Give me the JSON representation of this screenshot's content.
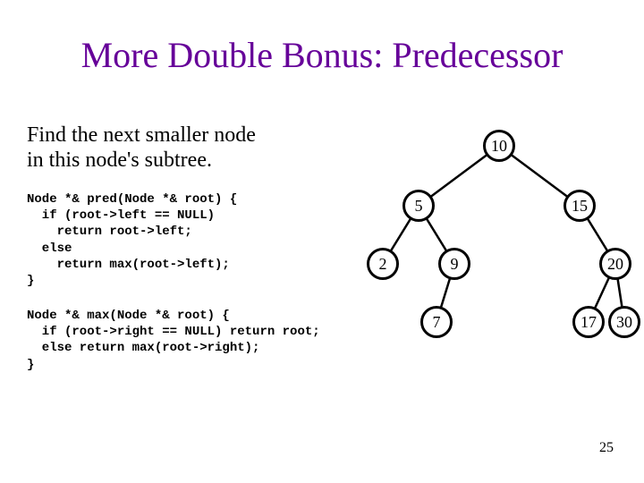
{
  "title": "More Double Bonus: Predecessor",
  "subtitle_l1": "Find the next smaller node",
  "subtitle_l2": "in this node's subtree.",
  "code1": "Node *& pred(Node *& root) {\n  if (root->left == NULL)\n    return root->left;\n  else\n    return max(root->left);\n}",
  "code2": "Node *& max(Node *& root) {\n  if (root->right == NULL) return root;\n  else return max(root->right);\n}",
  "slide_number": "25",
  "tree": {
    "n10": "10",
    "n5": "5",
    "n15": "15",
    "n2": "2",
    "n9": "9",
    "n20": "20",
    "n7": "7",
    "n17": "17",
    "n30": "30"
  }
}
